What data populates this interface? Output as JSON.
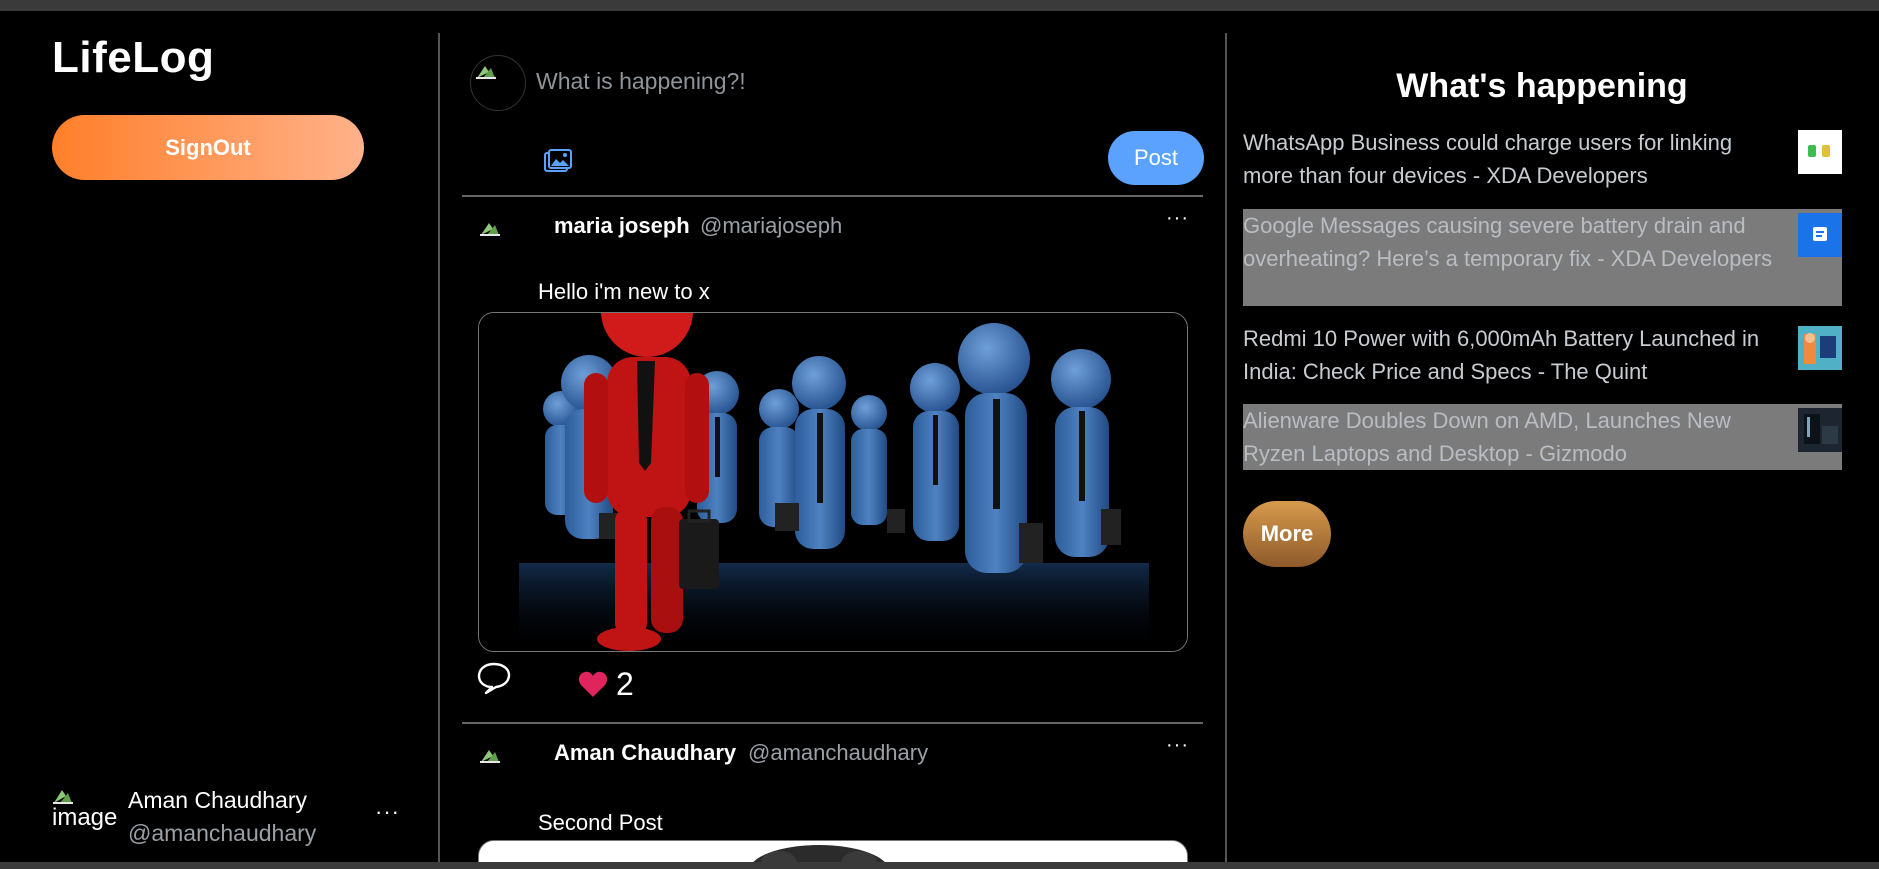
{
  "app": {
    "brand": "LifeLog"
  },
  "sidebar": {
    "signout_label": "SignOut",
    "user": {
      "avatar_alt": "image",
      "name": "Aman Chaudhary",
      "handle": "@amanchaudhary",
      "menu": "···"
    }
  },
  "composer": {
    "placeholder": "What is happening?!",
    "post_label": "Post",
    "media_icon": "image-icon"
  },
  "feed": {
    "posts": [
      {
        "author": "maria joseph",
        "handle": "@mariajoseph",
        "menu": "···",
        "text": "Hello i'm new to x",
        "image": "figures-crowd-illustration",
        "likes": "2",
        "liked": true
      },
      {
        "author": "Aman Chaudhary",
        "handle": "@amanchaudhary",
        "menu": "···",
        "text": "Second Post",
        "image": "portrait-photo"
      }
    ]
  },
  "trends": {
    "title": "What's happening",
    "items": [
      {
        "text": "WhatsApp Business could charge users for linking more than four devices - XDA Developers",
        "highlighted": false
      },
      {
        "text": "Google Messages causing severe battery drain and overheating? Here’s a temporary fix - XDA Developers",
        "highlighted": true
      },
      {
        "text": "Redmi 10 Power with 6,000mAh Battery Launched in India: Check Price and Specs - The Quint",
        "highlighted": false
      },
      {
        "text": "Alienware Doubles Down on AMD, Launches New Ryzen Laptops and Desktop - Gizmodo",
        "highlighted": true
      }
    ],
    "more_label": "More"
  },
  "colors": {
    "accent_blue": "#5ba2ff",
    "signout_start": "#ff7f2a",
    "signout_end": "#ffb18a",
    "like_red": "#e0245e",
    "highlight_bg": "#7b7b7b"
  }
}
